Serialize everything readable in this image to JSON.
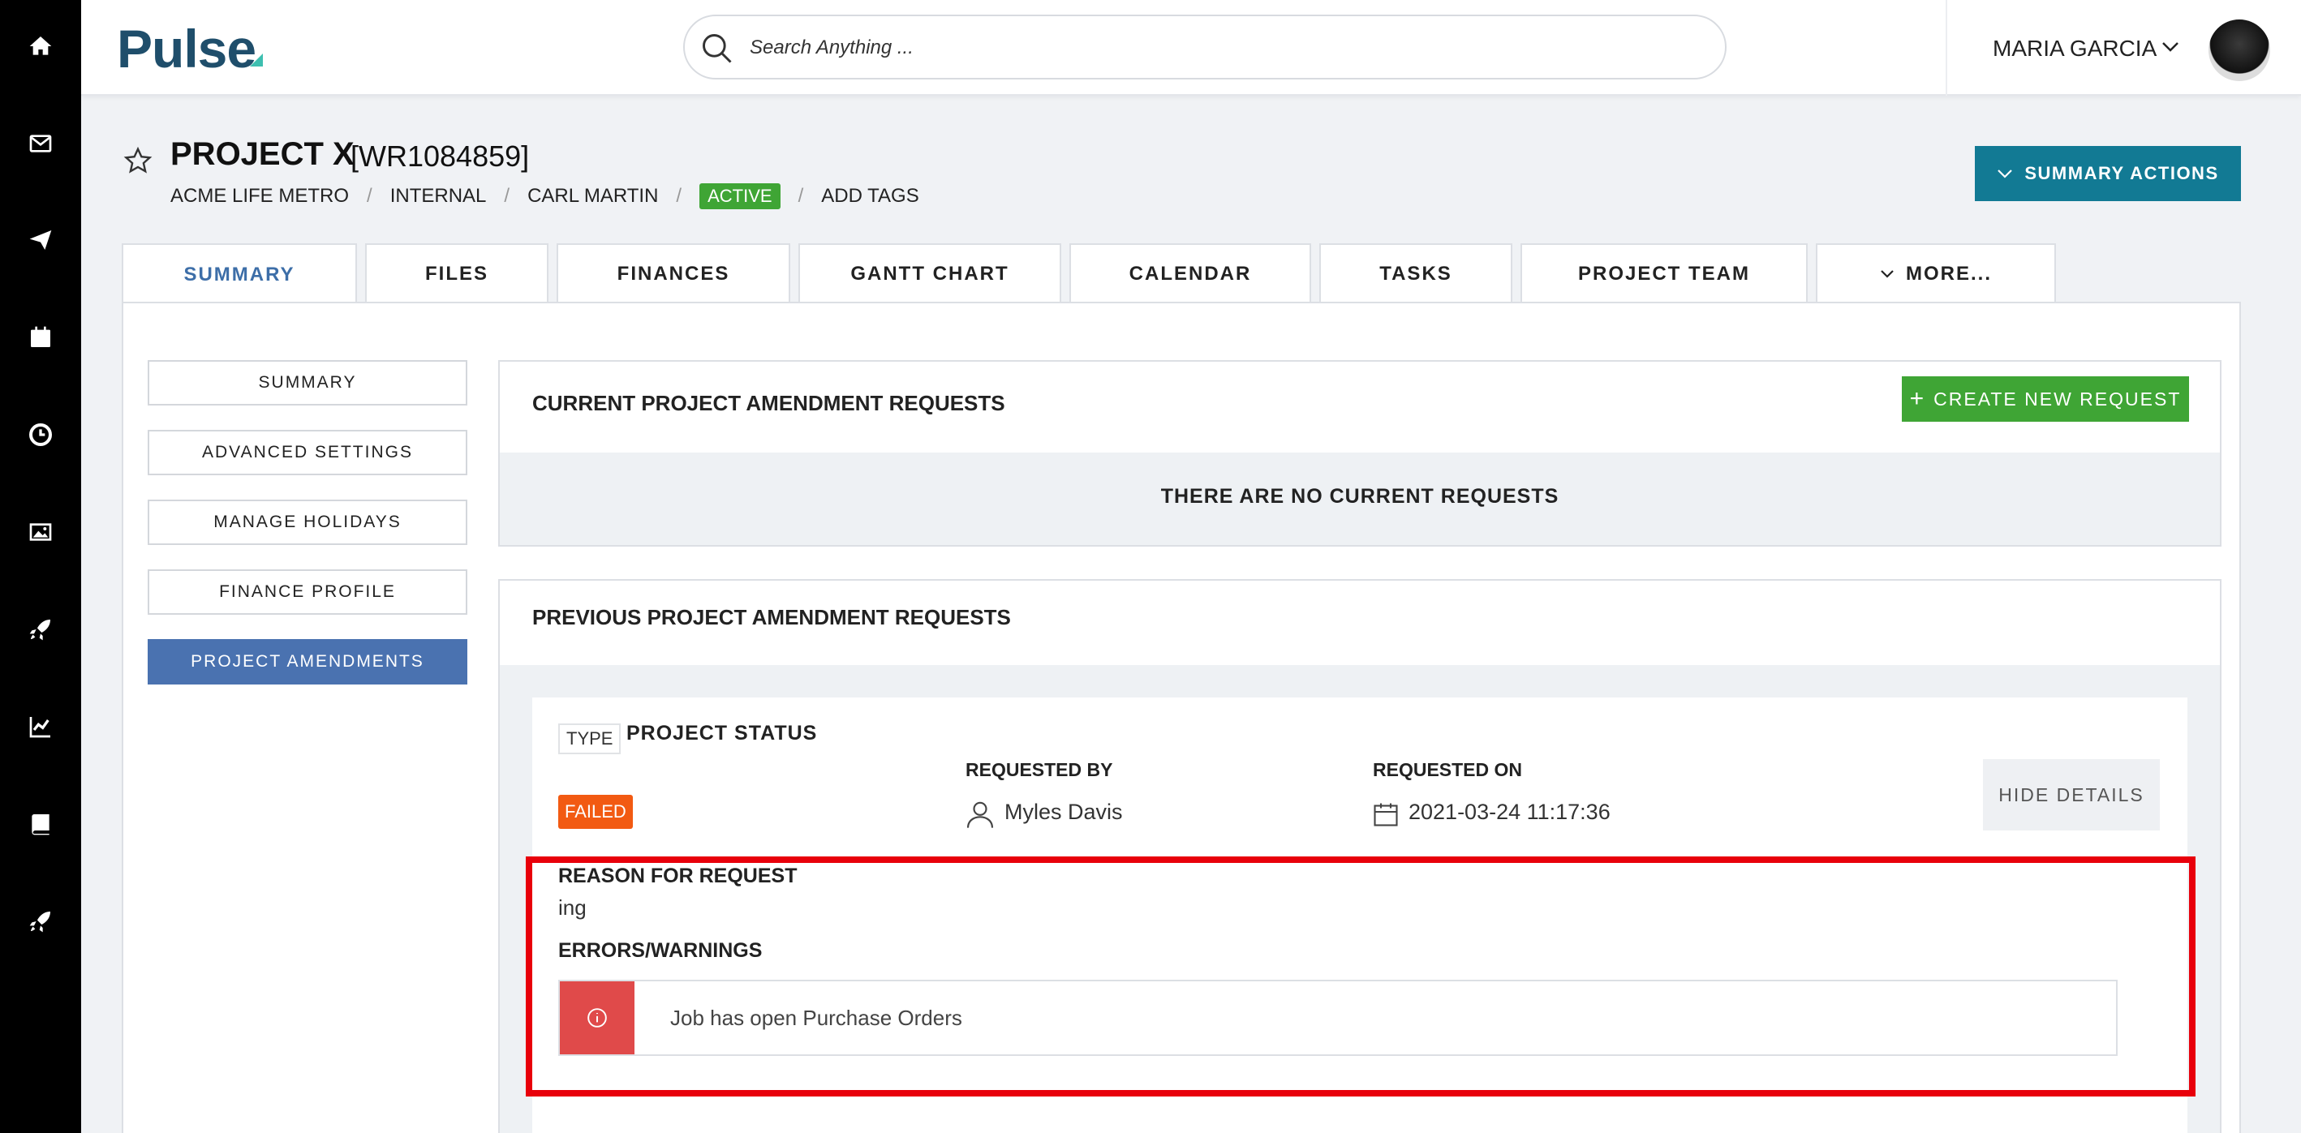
{
  "header": {
    "logo": "Pulse",
    "search_placeholder": "Search Anything ...",
    "user_name": "MARIA GARCIA"
  },
  "rail": {
    "icons": [
      "home-icon",
      "mail-icon",
      "send-icon",
      "calendar-icon",
      "clock-icon",
      "image-icon",
      "rocket-icon",
      "chart-icon",
      "book-icon",
      "rocket-icon"
    ]
  },
  "project": {
    "title": "PROJECT X",
    "code": "[WR1084859]",
    "client": "ACME LIFE METRO",
    "type": "INTERNAL",
    "manager": "CARL MARTIN",
    "status": "ACTIVE",
    "add_tags": "ADD TAGS",
    "summary_actions": "SUMMARY ACTIONS"
  },
  "tabs": [
    {
      "label": "SUMMARY"
    },
    {
      "label": "FILES"
    },
    {
      "label": "FINANCES"
    },
    {
      "label": "GANTT CHART"
    },
    {
      "label": "CALENDAR"
    },
    {
      "label": "TASKS"
    },
    {
      "label": "PROJECT TEAM"
    },
    {
      "label": "MORE..."
    }
  ],
  "side_nav": [
    {
      "label": "SUMMARY"
    },
    {
      "label": "ADVANCED SETTINGS"
    },
    {
      "label": "MANAGE HOLIDAYS"
    },
    {
      "label": "FINANCE PROFILE"
    },
    {
      "label": "PROJECT AMENDMENTS"
    }
  ],
  "current_requests": {
    "title": "CURRENT PROJECT AMENDMENT REQUESTS",
    "create_label": "CREATE NEW REQUEST",
    "empty_text": "THERE ARE NO CURRENT REQUESTS"
  },
  "previous_requests": {
    "title": "PREVIOUS PROJECT AMENDMENT REQUESTS",
    "item": {
      "type_label": "TYPE",
      "type_value": "PROJECT STATUS",
      "status": "FAILED",
      "requested_by_label": "REQUESTED BY",
      "requested_by": "Myles Davis",
      "requested_on_label": "REQUESTED ON",
      "requested_on": "2021-03-24 11:17:36",
      "hide_details": "HIDE DETAILS",
      "reason_label": "REASON FOR REQUEST",
      "reason": "ing",
      "errors_label": "ERRORS/WARNINGS",
      "error_text": "Job has open Purchase Orders"
    }
  },
  "colors": {
    "accent": "#127a94",
    "active_nav": "#4a72b0",
    "success": "#3fa535",
    "failed": "#f25a12",
    "error": "#e04a4a",
    "highlight": "#e8000b"
  }
}
